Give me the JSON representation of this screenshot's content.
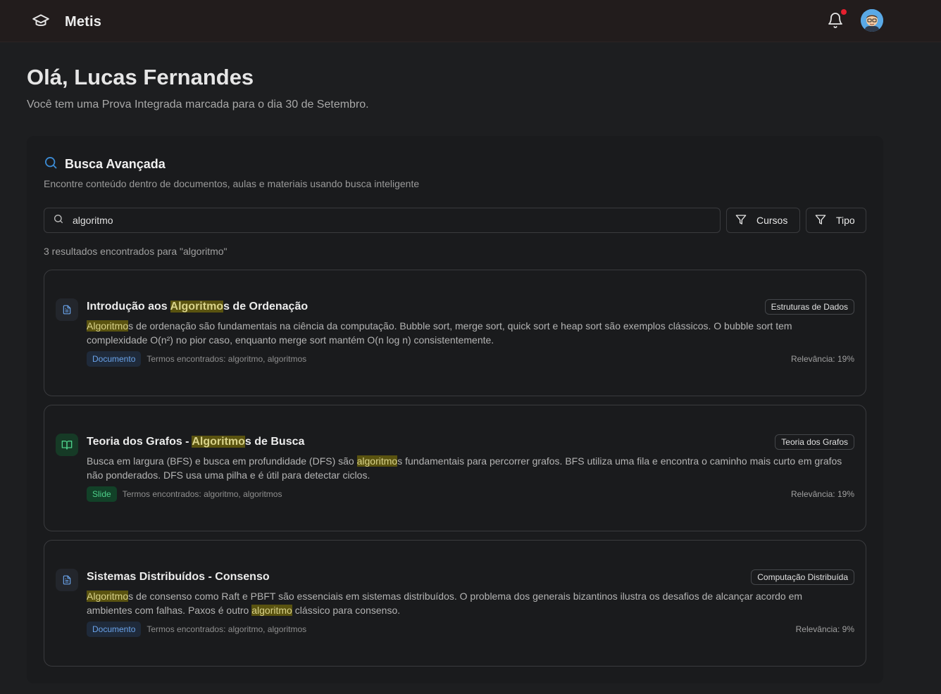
{
  "app": {
    "name": "Metis"
  },
  "colors": {
    "accent": "#3b8bd4",
    "notification": "#e5202f",
    "highlight": "#5a5310",
    "doc_badge": "#6aa3ea",
    "slide_badge": "#4ed08a"
  },
  "header": {
    "greeting": "Olá, Lucas Fernandes",
    "subtitle": "Você tem uma Prova Integrada marcada para o dia 30 de Setembro."
  },
  "search": {
    "title": "Busca Avançada",
    "description": "Encontre conteúdo dentro de documentos, aulas e materiais usando busca inteligente",
    "query": "algoritmo",
    "filters": {
      "courses_label": "Cursos",
      "type_label": "Tipo"
    },
    "results_count": "3 resultados encontrados para \"algoritmo\""
  },
  "results": [
    {
      "icon": "document-icon",
      "title_pre": "Introdução aos ",
      "title_mark": "Algoritmo",
      "title_post": "s de Ordenação",
      "course": "Estruturas de Dados",
      "snippet_parts": [
        {
          "mark": true,
          "text": "Algoritmo"
        },
        {
          "mark": false,
          "text": "s de ordenação são fundamentais na ciência da computação. Bubble sort, merge sort, quick sort e heap sort são exemplos clássicos. O bubble sort tem complexidade O(n²) no pior caso, enquanto merge sort mantém O(n log n) consistentemente."
        }
      ],
      "badge": "Documento",
      "terms": "Termos encontrados: algoritmo, algoritmos",
      "relevance": "Relevância: 19%"
    },
    {
      "icon": "book-icon",
      "title_pre": "Teoria dos Grafos - ",
      "title_mark": "Algoritmo",
      "title_post": "s de Busca",
      "course": "Teoria dos Grafos",
      "snippet_parts": [
        {
          "mark": false,
          "text": "Busca em largura (BFS) e busca em profundidade (DFS) são "
        },
        {
          "mark": true,
          "text": "algoritmo"
        },
        {
          "mark": false,
          "text": "s fundamentais para percorrer grafos. BFS utiliza uma fila e encontra o caminho mais curto em grafos não ponderados. DFS usa uma pilha e é útil para detectar ciclos."
        }
      ],
      "badge": "Slide",
      "terms": "Termos encontrados: algoritmo, algoritmos",
      "relevance": "Relevância: 19%"
    },
    {
      "icon": "document-icon",
      "title_pre": "Sistemas Distribuídos - Consenso",
      "title_mark": "",
      "title_post": "",
      "course": "Computação Distribuída",
      "snippet_parts": [
        {
          "mark": true,
          "text": "Algoritmo"
        },
        {
          "mark": false,
          "text": "s de consenso como Raft e PBFT são essenciais em sistemas distribuídos. O problema dos generais bizantinos ilustra os desafios de alcançar acordo em ambientes com falhas. Paxos é outro "
        },
        {
          "mark": true,
          "text": "algoritmo"
        },
        {
          "mark": false,
          "text": " clássico para consenso."
        }
      ],
      "badge": "Documento",
      "terms": "Termos encontrados: algoritmo, algoritmos",
      "relevance": "Relevância: 9%"
    }
  ]
}
